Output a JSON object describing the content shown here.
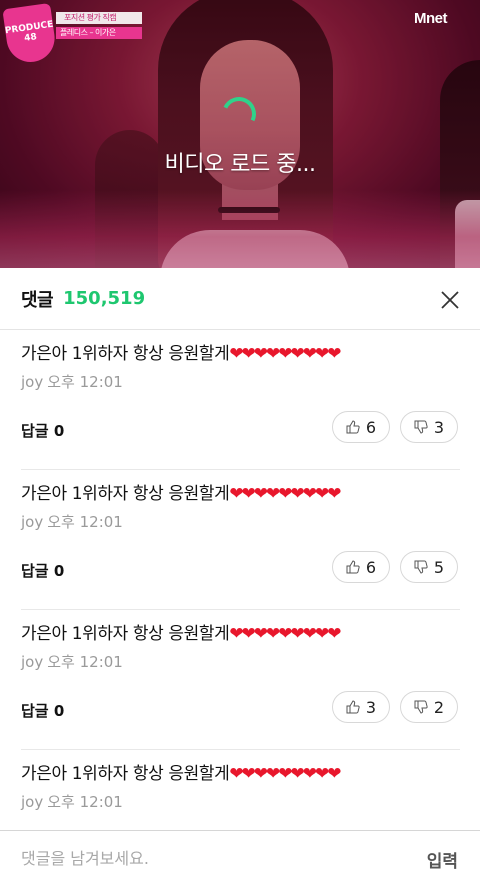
{
  "video": {
    "loading_text": "비디오 로드 중...",
    "badge_text": "PRODUCE 48",
    "caption_top": "포지션 평가 직캠",
    "caption_bottom": "플레디스 – 이가은",
    "channel_logo": "Mnet",
    "accent_color": "#e8358f",
    "spinner_color": "#2fd28a"
  },
  "comments_header": {
    "title": "댓글",
    "count": "150,519",
    "count_color": "#1ec76f",
    "close_icon": "close-icon"
  },
  "comments": [
    {
      "text": "가은아 1위하자 항상 응원할게",
      "hearts": "❤❤❤❤❤❤❤❤❤",
      "author": "joy",
      "time": "오후 12:01",
      "reply_label": "답글 0",
      "likes": "6",
      "dislikes": "3"
    },
    {
      "text": "가은아 1위하자 항상 응원할게",
      "hearts": "❤❤❤❤❤❤❤❤❤",
      "author": "joy",
      "time": "오후 12:01",
      "reply_label": "답글 0",
      "likes": "6",
      "dislikes": "5"
    },
    {
      "text": "가은아 1위하자 항상 응원할게",
      "hearts": "❤❤❤❤❤❤❤❤❤",
      "author": "joy",
      "time": "오후 12:01",
      "reply_label": "답글 0",
      "likes": "3",
      "dislikes": "2"
    },
    {
      "text": "가은아 1위하자 항상 응원할게",
      "hearts": "❤❤❤❤❤❤❤❤❤",
      "author": "joy",
      "time": "오후 12:01"
    }
  ],
  "input_bar": {
    "placeholder": "댓글을 남겨보세요.",
    "value": "",
    "submit_label": "입력"
  }
}
